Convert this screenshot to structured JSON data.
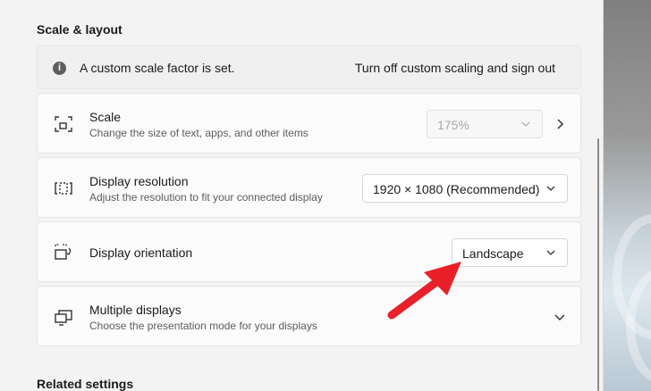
{
  "section": {
    "title": "Scale & layout",
    "related_title": "Related settings"
  },
  "info": {
    "message": "A custom scale factor is set.",
    "action": "Turn off custom scaling and sign out"
  },
  "scale": {
    "title": "Scale",
    "subtitle": "Change the size of text, apps, and other items",
    "value": "175%"
  },
  "resolution": {
    "title": "Display resolution",
    "subtitle": "Adjust the resolution to fit your connected display",
    "value": "1920 × 1080 (Recommended)"
  },
  "orientation": {
    "title": "Display orientation",
    "value": "Landscape"
  },
  "multiple": {
    "title": "Multiple displays",
    "subtitle": "Choose the presentation mode for your displays"
  },
  "colors": {
    "annotation_arrow": "#e8202a",
    "info_icon": "#5f5f5f"
  }
}
